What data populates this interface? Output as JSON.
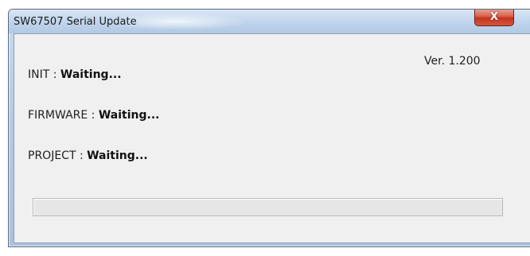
{
  "window": {
    "title": "SW67507 Serial Update",
    "close_symbol": "X"
  },
  "version": "Ver. 1.200",
  "status": {
    "init": {
      "label": "INIT : ",
      "value": "Waiting..."
    },
    "firmware": {
      "label": "FIRMWARE : ",
      "value": "Waiting..."
    },
    "project": {
      "label": "PROJECT : ",
      "value": "Waiting..."
    }
  },
  "progress": {
    "fraction": 0
  },
  "colors": {
    "titlebar": "#b9cfe9",
    "close_button": "#c4361f",
    "client_bg": "#f0f0f0",
    "progress_fill": "#06b025"
  },
  "icons": [
    "close-icon"
  ]
}
